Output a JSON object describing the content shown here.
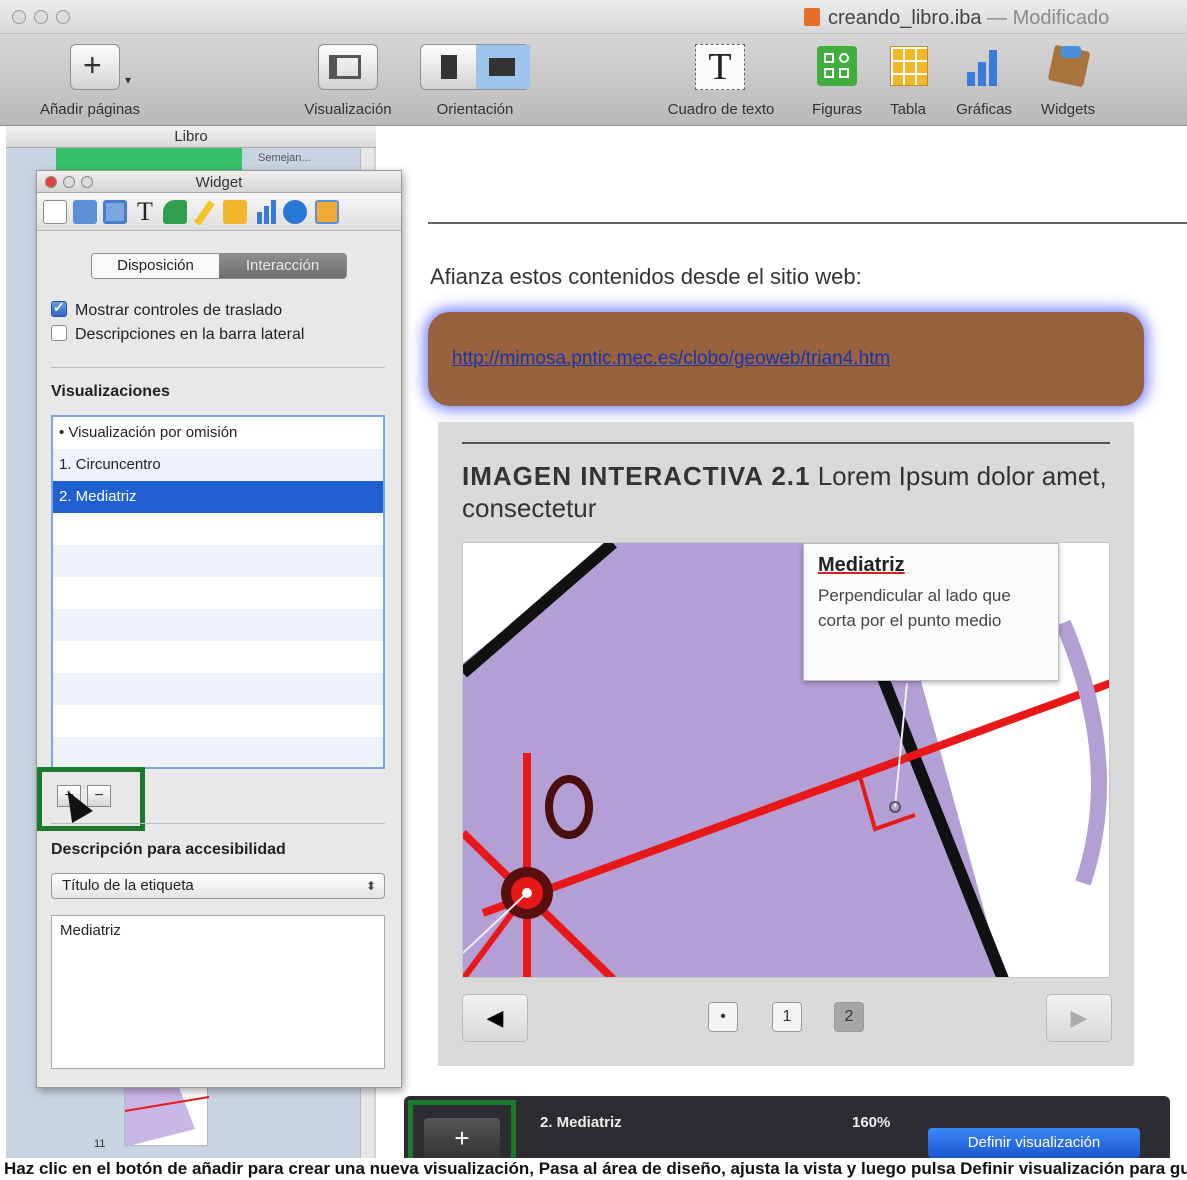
{
  "window": {
    "title": "creando_libro.iba",
    "separator": "—",
    "status": "Modificado"
  },
  "toolbar": {
    "add_pages": "Añadir páginas",
    "view": "Visualización",
    "orientation": "Orientación",
    "text_box": "Cuadro de texto",
    "shapes": "Figuras",
    "table": "Tabla",
    "charts": "Gráficas",
    "widgets": "Widgets"
  },
  "sidebar": {
    "header": "Libro",
    "thumb_label": "Semejan...",
    "thumb_number": "11"
  },
  "inspector": {
    "title": "Widget",
    "segments": [
      "Disposición",
      "Interacción"
    ],
    "active_segment": "Interacción",
    "checkboxes": [
      {
        "label": "Mostrar controles de traslado",
        "checked": true
      },
      {
        "label": "Descripciones en la barra lateral",
        "checked": false
      }
    ],
    "visualizations_heading": "Visualizaciones",
    "visualizations": [
      "• Visualización por omisión",
      "1. Circuncentro",
      "2. Mediatriz"
    ],
    "selected_visualization": "2. Mediatriz",
    "add_button": "+",
    "remove_button": "−",
    "accessibility_heading": "Descripción para accesibilidad",
    "accessibility_select": "Título de la etiqueta",
    "accessibility_text": "Mediatriz"
  },
  "canvas": {
    "intro": "Afianza estos contenidos desde el sitio web:",
    "link": "http://mimosa.pntic.mec.es/clobo/geoweb/trian4.htm",
    "widget_label": "IMAGEN INTERACTIVA 2.1",
    "widget_caption": "Lorem Ipsum dolor amet, consectetur",
    "callout_title": "Mediatriz",
    "callout_body": "Perpendicular al lado que corta por el punto medio",
    "image_letter": "O",
    "nav": {
      "prev": "◀",
      "next": "▶",
      "dot": "•",
      "pages": [
        "1",
        "2"
      ],
      "current_page": "2"
    }
  },
  "hud": {
    "add": "+",
    "view_name": "2. Mediatriz",
    "zoom": "160%",
    "define_button": "Definir visualización"
  },
  "colors": {
    "selection": "#1f5fd0",
    "highlight_box": "#1b7a2e",
    "link_box": "#98623f",
    "figure_fill": "#b39ed5",
    "figure_lines": "#e81818"
  },
  "icons": [
    "add-pages-icon",
    "view-icon",
    "orientation-icon",
    "text-box-icon",
    "shapes-icon",
    "table-icon",
    "charts-icon",
    "widgets-icon"
  ],
  "caption": "Haz clic en el botón de añadir para crear una nueva visualización, Pasa al área de diseño, ajusta la vista y luego pulsa Definir visualización para guardar el encuadre del widget en la imagen interactiva."
}
